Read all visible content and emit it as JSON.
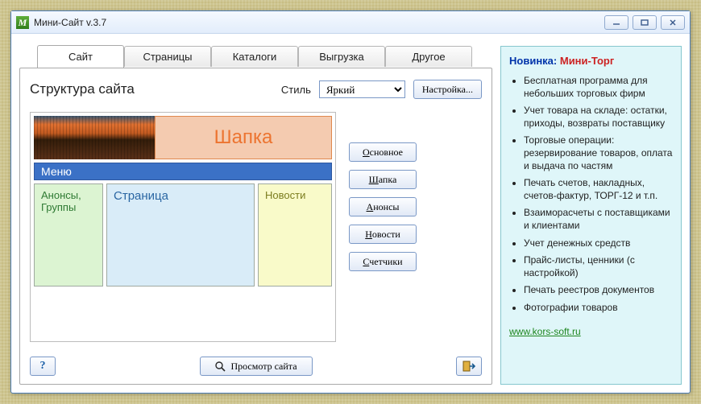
{
  "window": {
    "title": "Мини-Сайт v.3.7"
  },
  "tabs": [
    "Сайт",
    "Страницы",
    "Каталоги",
    "Выгрузка",
    "Другое"
  ],
  "heading": "Структура сайта",
  "style_label": "Стиль",
  "style_value": "Яркий",
  "settings_btn": "Настройка...",
  "mockup": {
    "header_caption": "Шапка",
    "menu_label": "Меню",
    "col_a_line1": "Анонсы,",
    "col_a_line2": "Группы",
    "col_b": "Страница",
    "col_c": "Новости"
  },
  "side_buttons": {
    "main": {
      "pre": "",
      "u": "О",
      "post": "сновное"
    },
    "header": {
      "pre": "",
      "u": "Ш",
      "post": "апка"
    },
    "anons": {
      "pre": "",
      "u": "А",
      "post": "нонсы"
    },
    "news": {
      "pre": "",
      "u": "Н",
      "post": "овости"
    },
    "counters": {
      "pre": "",
      "u": "С",
      "post": "четчики"
    }
  },
  "bottom": {
    "help": "?",
    "preview": "Просмотр сайта"
  },
  "promo": {
    "label": "Новинка:",
    "name": "Мини-Торг",
    "items": [
      "Бесплатная программа для небольших торговых фирм",
      "Учет товара на складе: остатки, приходы, возвраты поставщику",
      "Торговые операции: резервирование товаров, оплата и выдача по частям",
      "Печать счетов, накладных, счетов-фактур, ТОРГ-12 и т.п.",
      "Взаиморасчеты с поставщиками и клиентами",
      "Учет денежных средств",
      "Прайс-листы, ценники (с настройкой)",
      "Печать реестров документов",
      "Фотографии товаров"
    ],
    "link": "www.kors-soft.ru"
  }
}
